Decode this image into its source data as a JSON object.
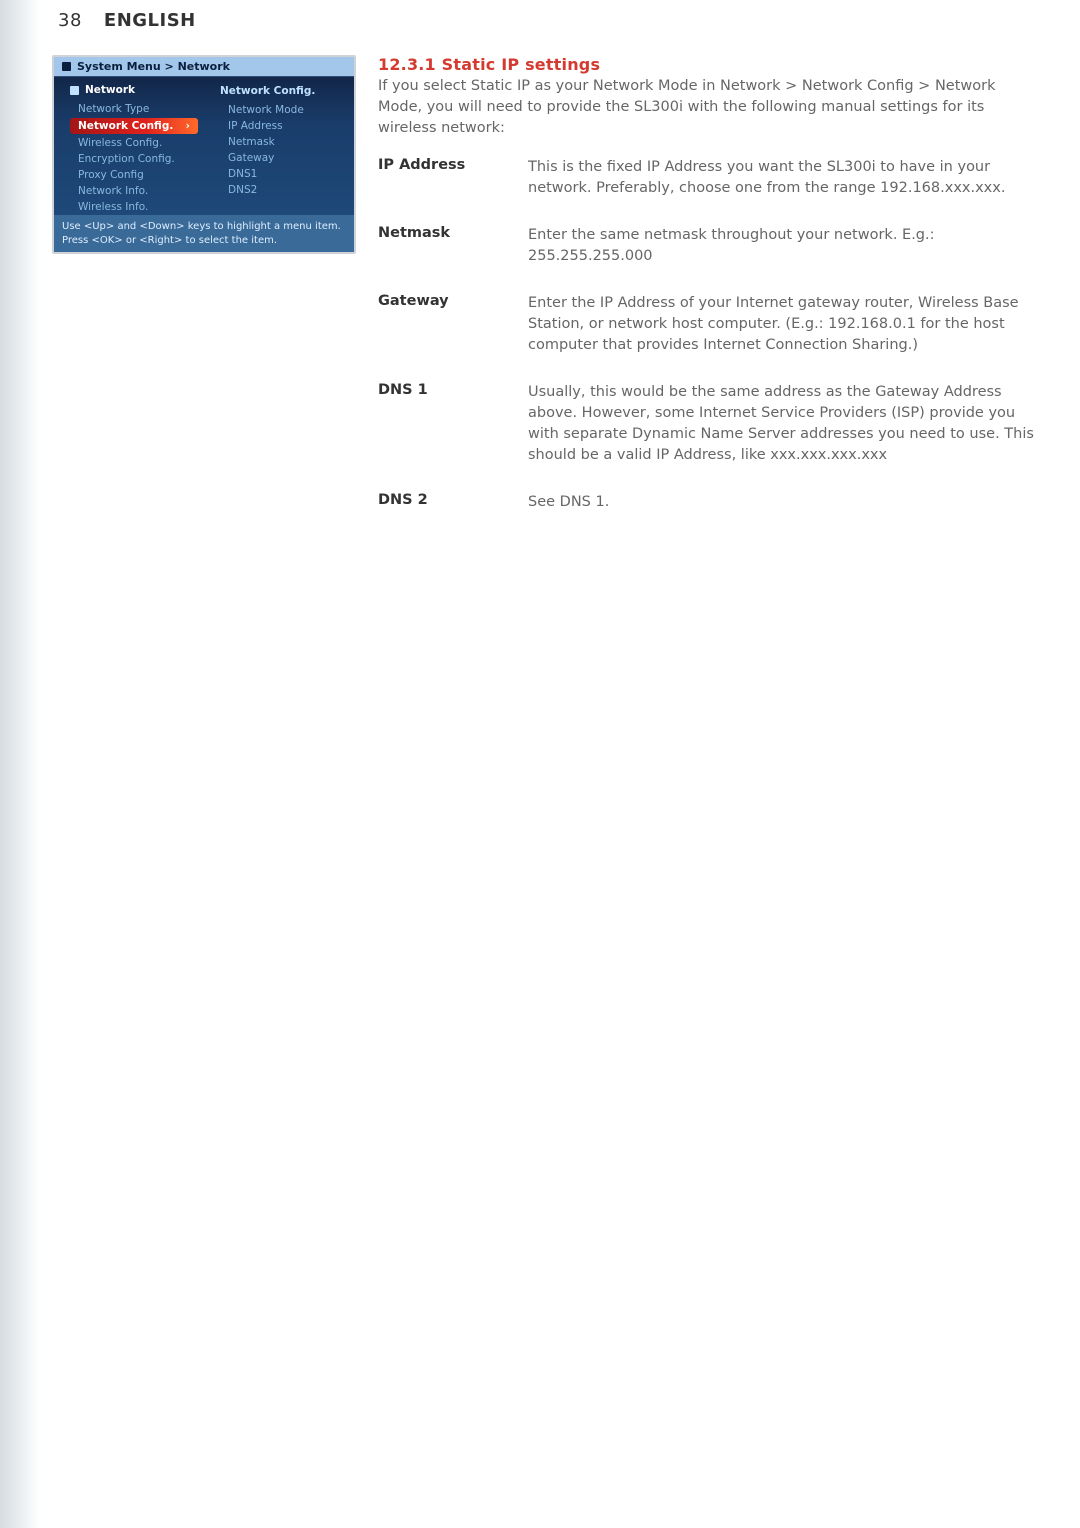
{
  "header": {
    "page_number": "38",
    "language": "ENGLISH"
  },
  "screenshot": {
    "breadcrumb": "System Menu > Network",
    "left_panel": {
      "header": "Network",
      "items": [
        "Network Type",
        "Network Config.",
        "Wireless Config.",
        "Encryption Config.",
        "Proxy Config",
        "Network Info.",
        "Wireless Info."
      ],
      "active_index": 1
    },
    "right_panel": {
      "header": "Network Config.",
      "items": [
        "Network Mode",
        "IP Address",
        "Netmask",
        "Gateway",
        "DNS1",
        "DNS2"
      ]
    },
    "hint_line1": "Use <Up> and <Down> keys to highlight a menu item.",
    "hint_line2": "Press <OK> or <Right> to select the item."
  },
  "section": {
    "heading": "12.3.1 Static IP settings",
    "intro": "If you select Static IP as your Network Mode in Network > Network Config > Network Mode, you will need to provide the SL300i with the following manual settings for its wireless network:",
    "defs": [
      {
        "term": "IP Address",
        "desc": "This is the fixed IP Address you want the SL300i to have in your network. Preferably, choose one from the range 192.168.xxx.xxx."
      },
      {
        "term": "Netmask",
        "desc": "Enter the same netmask throughout your network. E.g.: 255.255.255.000"
      },
      {
        "term": "Gateway",
        "desc": "Enter the IP Address of your Internet gateway router, Wireless Base Station, or network host computer. (E.g.: 192.168.0.1 for the host computer that provides Internet Connection Sharing.)"
      },
      {
        "term": "DNS 1",
        "desc": "Usually, this would be the same address as the Gateway Address above. However, some Internet Service Providers (ISP) provide you with separate Dynamic Name Server addresses you need to use. This should be a valid IP Address, like xxx.xxx.xxx.xxx"
      },
      {
        "term": "DNS 2",
        "desc": "See DNS 1."
      }
    ]
  }
}
